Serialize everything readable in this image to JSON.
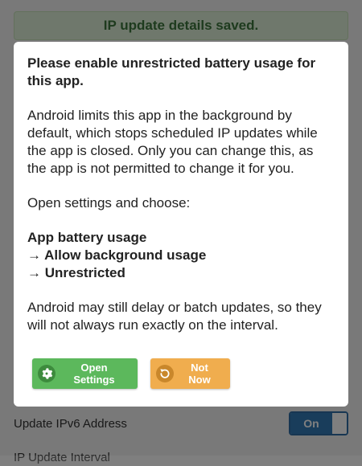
{
  "banner": {
    "text": "IP update details saved."
  },
  "settings": {
    "ipv6_label": "Update IPv6 Address",
    "ipv6_toggle": "On",
    "interval_label": "IP Update Interval"
  },
  "dialog": {
    "title": "Please enable unrestricted battery usage for this app.",
    "paragraph1": "Android limits this app in the background by default, which stops scheduled IP updates while the app is closed. Only you can change this, as the app is not permitted to change it for you.",
    "paragraph2": "Open settings and choose:",
    "steps": [
      "App battery usage",
      "→ Allow background usage",
      "→ Unrestricted"
    ],
    "paragraph3": "Android may still delay or batch updates, so they will not always run exactly on the interval.",
    "open_settings_label": "Open Settings",
    "not_now_label": "Not Now",
    "open_settings_icon": "gear-icon",
    "not_now_icon": "undo-arrow-icon"
  },
  "colors": {
    "success": "#5cb85c",
    "warning": "#f0ad4e",
    "primary": "#337ab7",
    "banner_text": "#3c763d"
  }
}
